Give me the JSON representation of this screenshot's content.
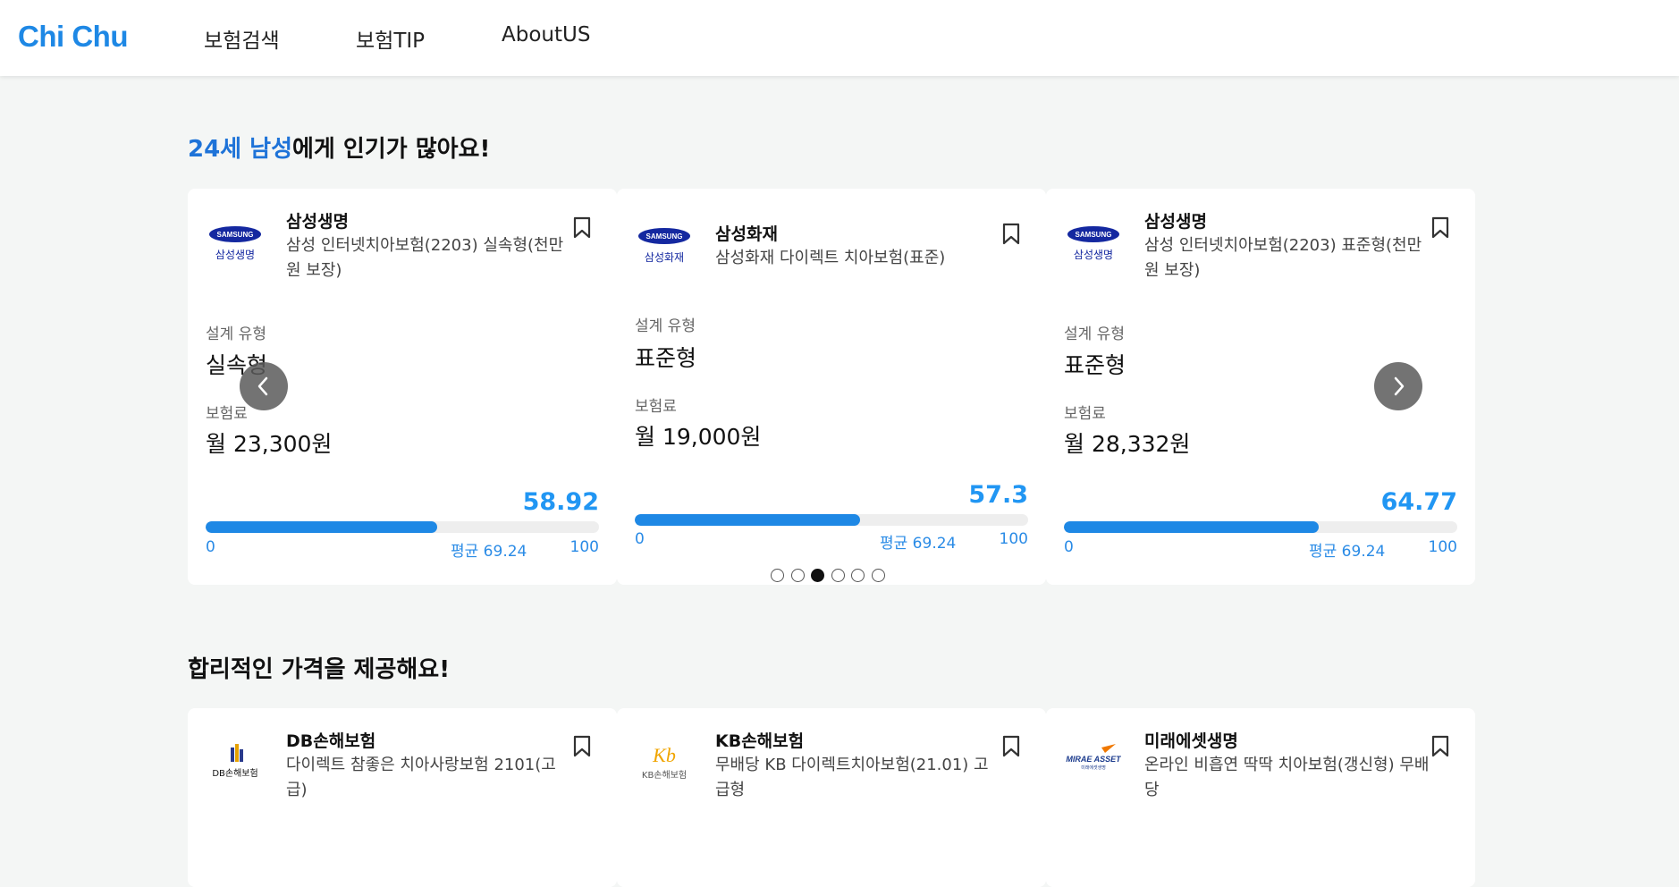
{
  "header": {
    "logo": "Chi Chu",
    "nav": [
      "보험검색",
      "보험TIP",
      "AboutUS"
    ]
  },
  "section1": {
    "title_highlight": "24세 남성",
    "title_rest": "에게 인기가 많아요!",
    "cards": [
      {
        "logo_brand": "SAMSUNG",
        "logo_sub": "삼성생명",
        "company": "삼성생명",
        "product": "삼성 인터넷치아보험(2203) 실속형(천만원 보장)",
        "type_label": "설계 유형",
        "type_value": "실속형",
        "premium_label": "보험료",
        "premium_value": "월 23,300원",
        "score": "58.92",
        "score_fraction": 0.5892,
        "axis_min": "0",
        "axis_avg": "평균 69.24",
        "axis_max": "100"
      },
      {
        "logo_brand": "SAMSUNG",
        "logo_sub": "삼성화재",
        "company": "삼성화재",
        "product": "삼성화재 다이렉트 치아보험(표준)",
        "type_label": "설계 유형",
        "type_value": "표준형",
        "premium_label": "보험료",
        "premium_value": "월 19,000원",
        "score": "57.3",
        "score_fraction": 0.573,
        "axis_min": "0",
        "axis_avg": "평균 69.24",
        "axis_max": "100"
      },
      {
        "logo_brand": "SAMSUNG",
        "logo_sub": "삼성생명",
        "company": "삼성생명",
        "product": "삼성 인터넷치아보험(2203) 표준형(천만원 보장)",
        "type_label": "설계 유형",
        "type_value": "표준형",
        "premium_label": "보험료",
        "premium_value": "월 28,332원",
        "score": "64.77",
        "score_fraction": 0.6477,
        "axis_min": "0",
        "axis_avg": "평균 69.24",
        "axis_max": "100"
      }
    ],
    "carousel": {
      "dot_count": 6,
      "active_index": 2,
      "prev_icon": "chevron-left-icon",
      "next_icon": "chevron-right-icon"
    }
  },
  "section2": {
    "title": "합리적인 가격을 제공해요!",
    "cards": [
      {
        "logo_brand": "DB손해보험",
        "company": "DB손해보험",
        "product": "다이렉트 참좋은 치아사랑보험 2101(고급)"
      },
      {
        "logo_brand": "KB손해보험",
        "company": "KB손해보험",
        "product": "무배당 KB 다이렉트치아보험(21.01) 고급형"
      },
      {
        "logo_brand": "MIRAE ASSET",
        "logo_sub": "미래에셋생명",
        "company": "미래에셋생명",
        "product": "온라인 비흡연 딱딱 치아보험(갱신형) 무배당"
      }
    ]
  },
  "colors": {
    "accent": "#1e88e5",
    "samsung_blue": "#1428a0"
  }
}
